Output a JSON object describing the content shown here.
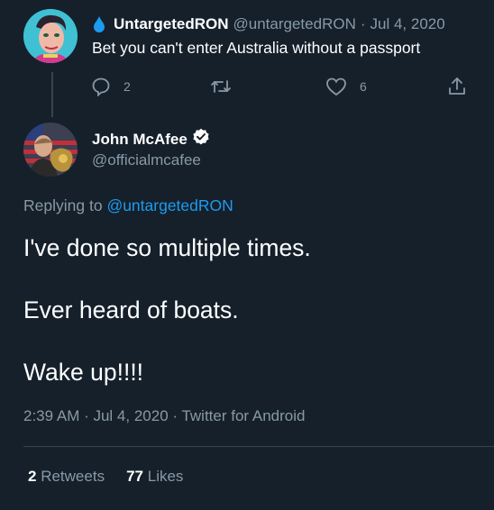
{
  "parent_tweet": {
    "display_name": "UntargetedRON",
    "handle": "@untargetedRON",
    "separator": "·",
    "date": "Jul 4, 2020",
    "text": "Bet you can't enter Australia without a passport",
    "replies": "2",
    "retweets": "",
    "likes": "6"
  },
  "main_tweet": {
    "display_name": "John McAfee",
    "handle": "@officialmcafee",
    "replying_prefix": "Replying to",
    "replying_to": "@untargetedRON",
    "lines": [
      "I've done so multiple times.",
      "Ever heard of boats.",
      "Wake up!!!!"
    ],
    "timestamp": "2:39 AM · Jul 4, 2020 · Twitter for Android",
    "retweet_count": "2",
    "retweet_label": "Retweets",
    "like_count": "77",
    "like_label": "Likes"
  },
  "colors": {
    "background": "#15202b",
    "secondary_text": "#8899a6",
    "link": "#1d9bf0",
    "divider": "#38444d"
  },
  "icons": [
    "water-drop-icon",
    "reply-icon",
    "retweet-icon",
    "like-icon",
    "share-icon",
    "verified-badge-icon"
  ]
}
